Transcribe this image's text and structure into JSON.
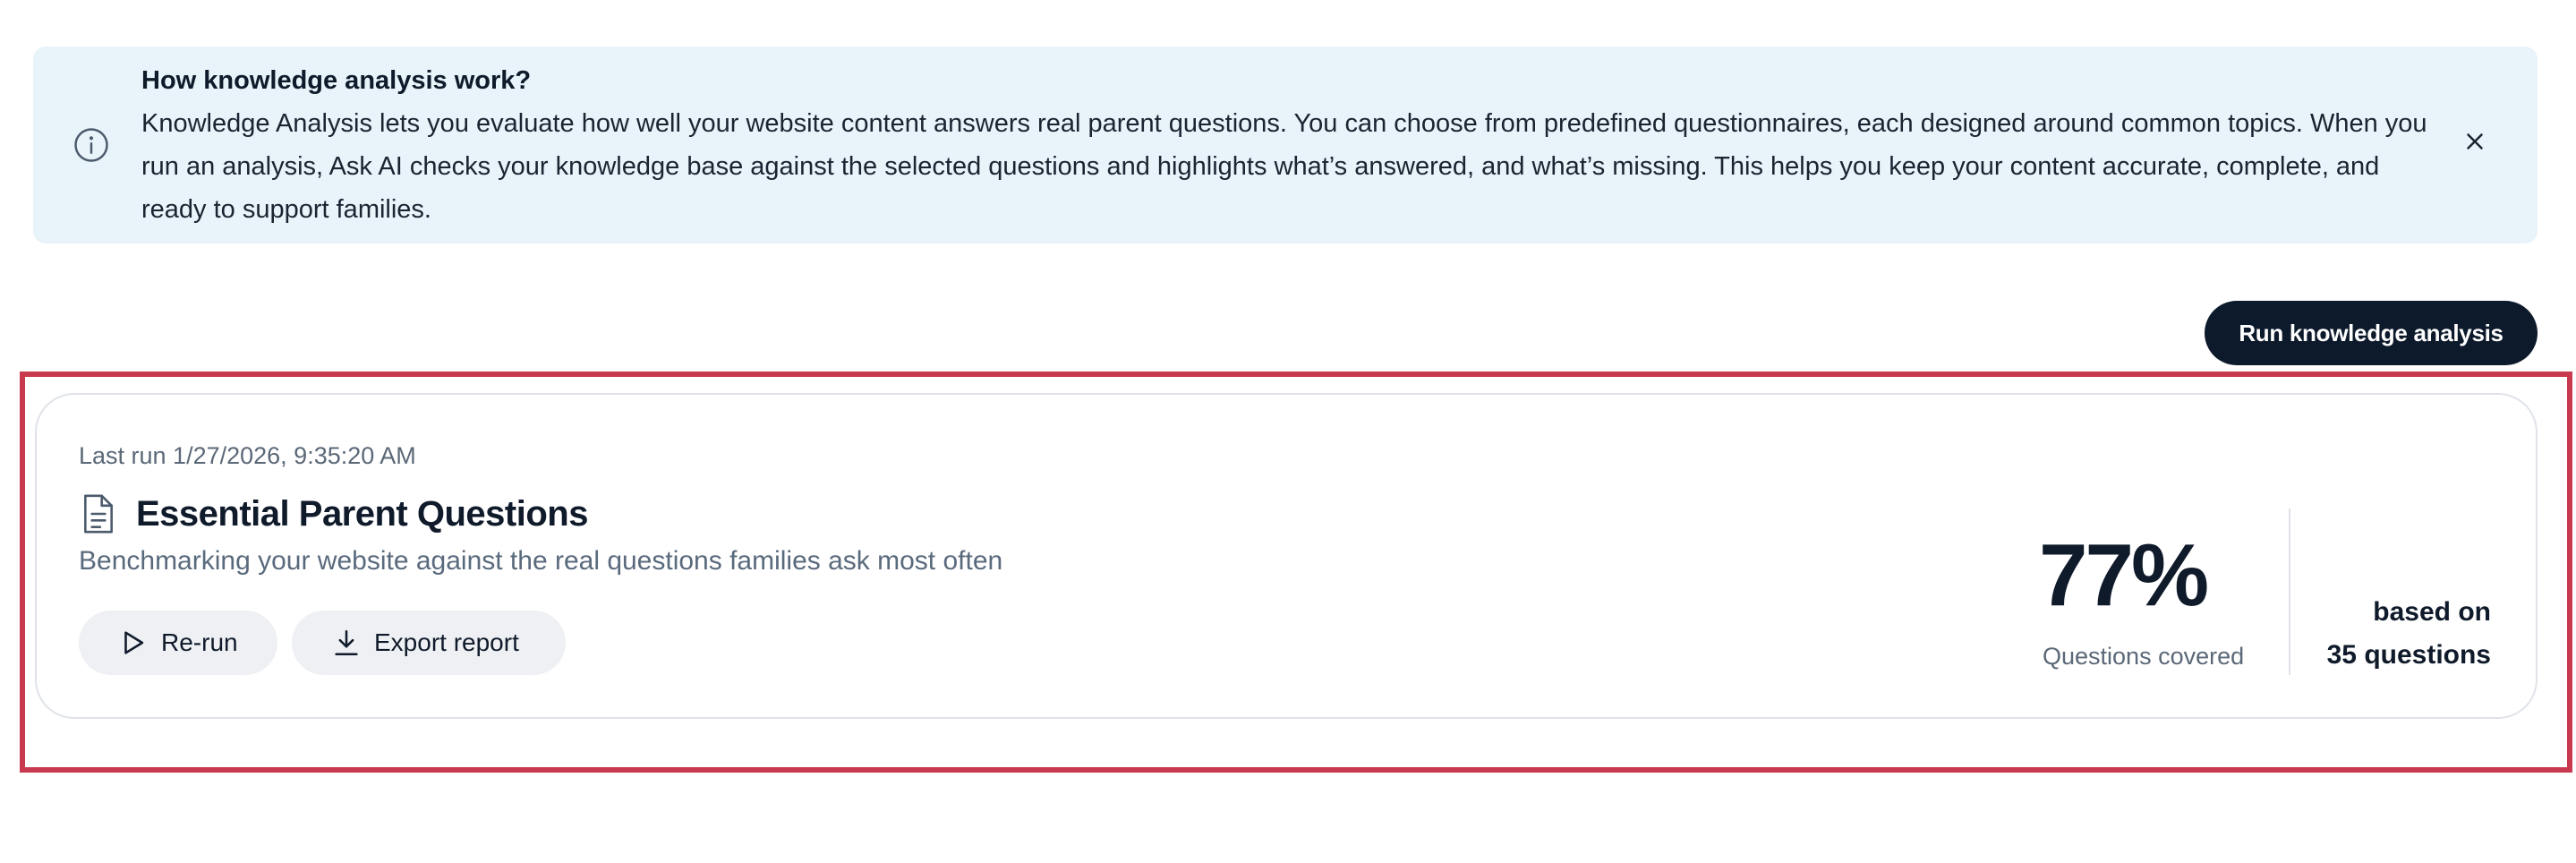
{
  "banner": {
    "title": "How knowledge analysis work?",
    "body": "Knowledge Analysis lets you evaluate how well your website content answers real parent questions. You can choose from predefined questionnaires, each designed around common topics. When you run an analysis, Ask AI checks your knowledge base against the selected questions and highlights what’s answered, and what’s missing. This helps you keep your content accurate, complete, and ready to support families.",
    "info_icon": "info-icon",
    "close_icon": "close-icon"
  },
  "actions": {
    "run_label": "Run knowledge analysis"
  },
  "result": {
    "last_run": "Last run 1/27/2026, 9:35:20 AM",
    "title": "Essential Parent Questions",
    "subtitle": "Benchmarking your website against the real questions families ask most often",
    "rerun_label": "Re-run",
    "export_label": "Export report",
    "percent": "77%",
    "percent_label": "Questions covered",
    "based_on_line1": "based on",
    "based_on_line2": "35 questions",
    "doc_icon": "document-icon",
    "rerun_icon": "play-icon",
    "export_icon": "download-icon"
  },
  "colors": {
    "banner_bg": "#e8f3fa",
    "primary_button": "#0d1a2b",
    "highlight": "#c8384e",
    "pill_bg": "#eef0f3"
  }
}
